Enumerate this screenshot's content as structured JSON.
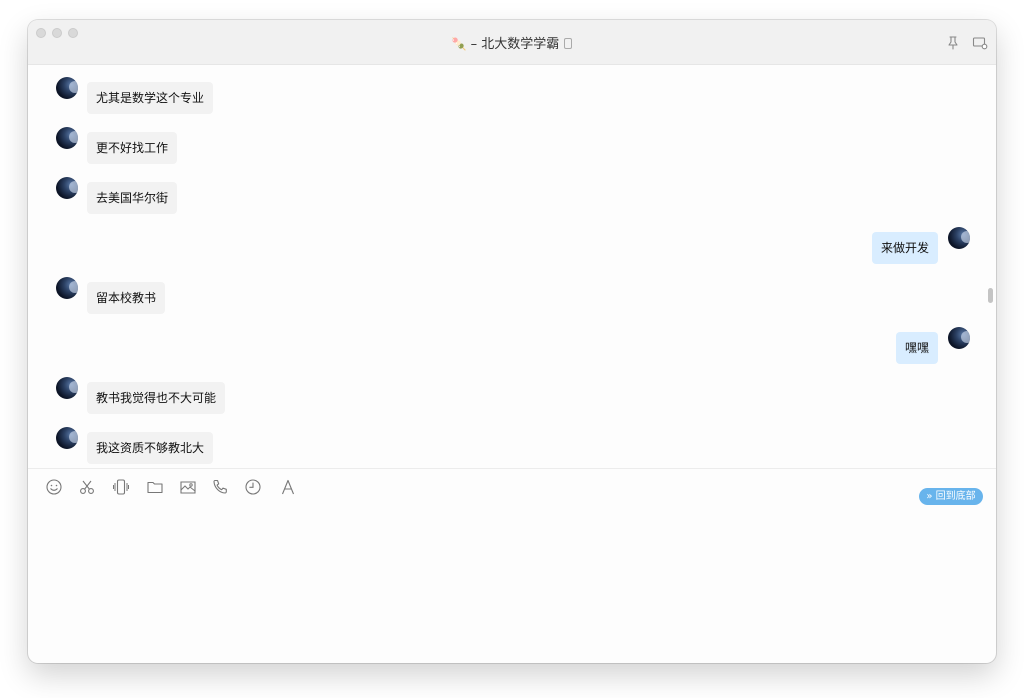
{
  "window": {
    "title_emoji": "🍡",
    "title_separator": "–",
    "title": "北大数学学霸"
  },
  "titlebar_icons": [
    {
      "name": "pin-icon"
    },
    {
      "name": "chat-settings-icon"
    }
  ],
  "messages": [
    {
      "side": "in",
      "text": "尤其是数学这个专业"
    },
    {
      "side": "in",
      "text": "更不好找工作"
    },
    {
      "side": "in",
      "text": "去美国华尔街"
    },
    {
      "side": "out",
      "text": "来做开发"
    },
    {
      "side": "in",
      "text": "留本校教书"
    },
    {
      "side": "out",
      "text": "嘿嘿"
    },
    {
      "side": "in",
      "text": "教书我觉得也不大可能"
    },
    {
      "side": "in",
      "text": "我这资质不够教北大"
    }
  ],
  "back_to_bottom": {
    "icon": "double-chevron-down-icon",
    "label": "回到底部",
    "color": "#68b4ec"
  },
  "toolbar": [
    {
      "name": "emoji-icon"
    },
    {
      "name": "scissors-icon"
    },
    {
      "name": "shake-icon"
    },
    {
      "name": "folder-icon"
    },
    {
      "name": "image-icon"
    },
    {
      "name": "phone-icon"
    },
    {
      "name": "history-clock-icon"
    },
    {
      "name": "font-icon"
    }
  ],
  "colors": {
    "incoming_bubble": "#f2f2f2",
    "outgoing_bubble": "#d9edff",
    "accent": "#68b4ec"
  }
}
